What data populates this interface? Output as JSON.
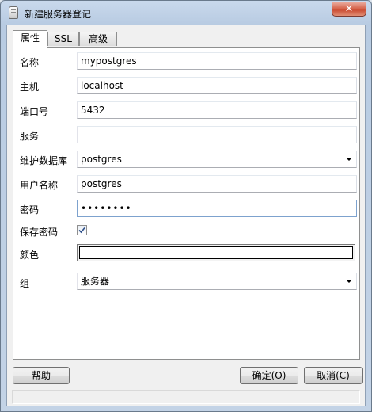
{
  "window": {
    "title": "新建服务器登记"
  },
  "tabs": [
    {
      "label": "属性"
    },
    {
      "label": "SSL"
    },
    {
      "label": "高级"
    }
  ],
  "form": {
    "name": {
      "label": "名称",
      "value": "mypostgres"
    },
    "host": {
      "label": "主机",
      "value": "localhost"
    },
    "port": {
      "label": "端口号",
      "value": "5432"
    },
    "service": {
      "label": "服务",
      "value": ""
    },
    "maintenance_db": {
      "label": "维护数据库",
      "value": "postgres"
    },
    "username": {
      "label": "用户名称",
      "value": "postgres"
    },
    "password": {
      "label": "密码",
      "value": "••••••••"
    },
    "save_password": {
      "label": "保存密码",
      "checked": true
    },
    "color": {
      "label": "颜色",
      "value_hex": "#ffffff"
    },
    "group": {
      "label": "组",
      "value": "服务器"
    }
  },
  "buttons": {
    "help": "帮助",
    "ok": "确定(O)",
    "cancel": "取消(C)"
  }
}
